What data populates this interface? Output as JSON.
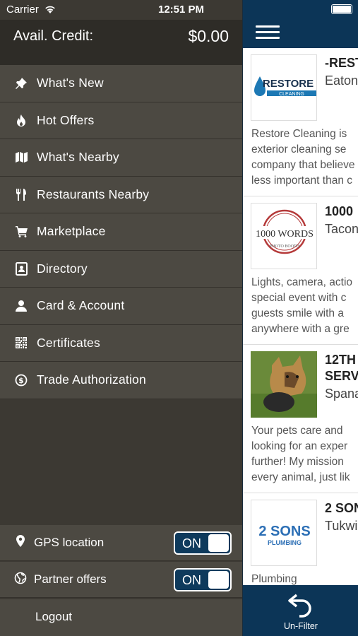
{
  "status_bar": {
    "carrier": "Carrier",
    "time": "12:51 PM"
  },
  "credit": {
    "label": "Avail. Credit:",
    "value": "$0.00"
  },
  "menu": {
    "items": [
      {
        "label": "What's New",
        "icon": "pin-icon"
      },
      {
        "label": "Hot Offers",
        "icon": "flame-icon"
      },
      {
        "label": "What's Nearby",
        "icon": "map-icon"
      },
      {
        "label": "Restaurants Nearby",
        "icon": "cutlery-icon"
      },
      {
        "label": "Marketplace",
        "icon": "cart-icon"
      },
      {
        "label": "Directory",
        "icon": "contact-card-icon"
      },
      {
        "label": "Card & Account",
        "icon": "person-icon"
      },
      {
        "label": "Certificates",
        "icon": "qr-code-icon"
      },
      {
        "label": "Trade Authorization",
        "icon": "dollar-circle-icon"
      }
    ]
  },
  "settings": {
    "gps": {
      "label": "GPS location",
      "state": "ON"
    },
    "partner": {
      "label": "Partner offers",
      "state": "ON"
    },
    "logout": {
      "label": "Logout"
    }
  },
  "listings": [
    {
      "title": "-REST",
      "city": "Eaton",
      "logo_text": "RESTORE",
      "logo_sub": "CLEANING",
      "desc": [
        "Restore Cleaning is",
        "exterior cleaning se",
        "company that believe",
        "less important than c"
      ]
    },
    {
      "title": "1000",
      "city": "Tacon",
      "logo_text": "1000 WORDS",
      "logo_sub": "PHOTO BOOTH",
      "desc": [
        "Lights, camera, actio",
        "special event with c",
        "guests smile with a",
        "anywhere with a gre"
      ]
    },
    {
      "title": "12TH",
      "title2": "SERV",
      "city": "Spana",
      "desc": [
        "Your pets care and",
        "looking for an exper",
        "further! My mission",
        "every animal, just lik"
      ]
    },
    {
      "title": "2 SON",
      "city": "Tukwi",
      "logo_text": "2 SONS",
      "logo_sub": "PLUMBING",
      "desc": [
        "Plumbing"
      ]
    }
  ],
  "footer": {
    "unfilter_label": "Un-Filter"
  },
  "colors": {
    "navy": "#0c3557",
    "drawer_bg": "#3c3933",
    "menu_row": "#4c4942"
  }
}
